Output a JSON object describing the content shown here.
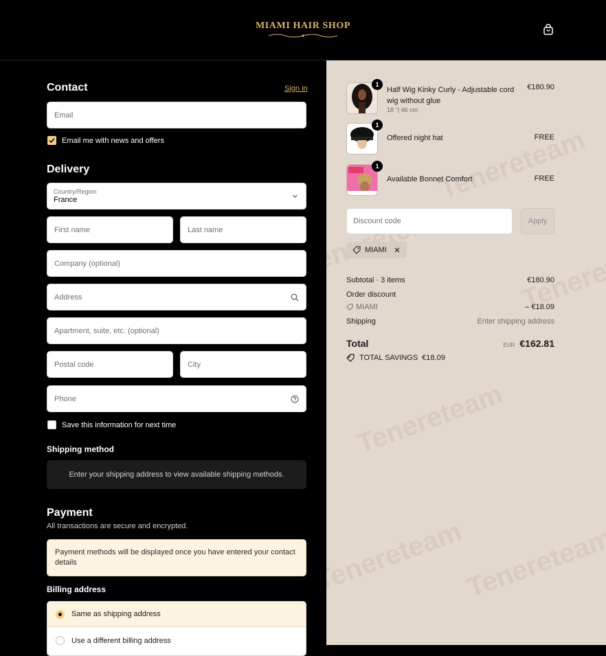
{
  "header": {
    "logo_text": "MIAMI HAIR SHOP",
    "cart_icon": "shopping-bag-icon"
  },
  "contact": {
    "heading": "Contact",
    "signin_label": "Sign in",
    "email_placeholder": "Email",
    "newsletter_label": "Email me with news and offers",
    "newsletter_checked": true
  },
  "delivery": {
    "heading": "Delivery",
    "country_label": "Country/Region",
    "country_value": "France",
    "first_name_placeholder": "First name",
    "last_name_placeholder": "Last name",
    "company_placeholder": "Company (optional)",
    "address_placeholder": "Address",
    "apartment_placeholder": "Apartment, suite, etc. (optional)",
    "postal_placeholder": "Postal code",
    "city_placeholder": "City",
    "phone_placeholder": "Phone",
    "save_info_label": "Save this information for next time",
    "save_info_checked": false
  },
  "shipping": {
    "heading": "Shipping method",
    "message": "Enter your shipping address to view available shipping methods."
  },
  "payment": {
    "heading": "Payment",
    "subtext": "All transactions are secure and encrypted.",
    "message": "Payment methods will be displayed once you have entered your contact details"
  },
  "billing": {
    "heading": "Billing address",
    "options": [
      {
        "label": "Same as shipping address",
        "selected": true
      },
      {
        "label": "Use a different billing address",
        "selected": false
      }
    ]
  },
  "summary": {
    "watermark": "Tenereteam",
    "items": [
      {
        "qty": "1",
        "name": "Half Wig Kinky Curly - Adjustable cord wig without glue",
        "variant": "18 \"| 46 cm",
        "price": "€180.90"
      },
      {
        "qty": "1",
        "name": "Offered night hat",
        "variant": "",
        "price": "FREE"
      },
      {
        "qty": "1",
        "name": "Available Bonnet Comfort",
        "variant": "",
        "price": "FREE"
      }
    ],
    "discount_placeholder": "Discount code",
    "apply_label": "Apply",
    "applied_code": "MIAMI",
    "subtotal_label": "Subtotal · 3 items",
    "subtotal_value": "€180.90",
    "order_discount_label": "Order discount",
    "discount_code": "MIAMI",
    "discount_value": "– €18.09",
    "shipping_label": "Shipping",
    "shipping_value": "Enter shipping address",
    "total_label": "Total",
    "currency": "EUR",
    "total_value": "€162.81",
    "savings_label": "TOTAL SAVINGS",
    "savings_value": "€18.09"
  }
}
